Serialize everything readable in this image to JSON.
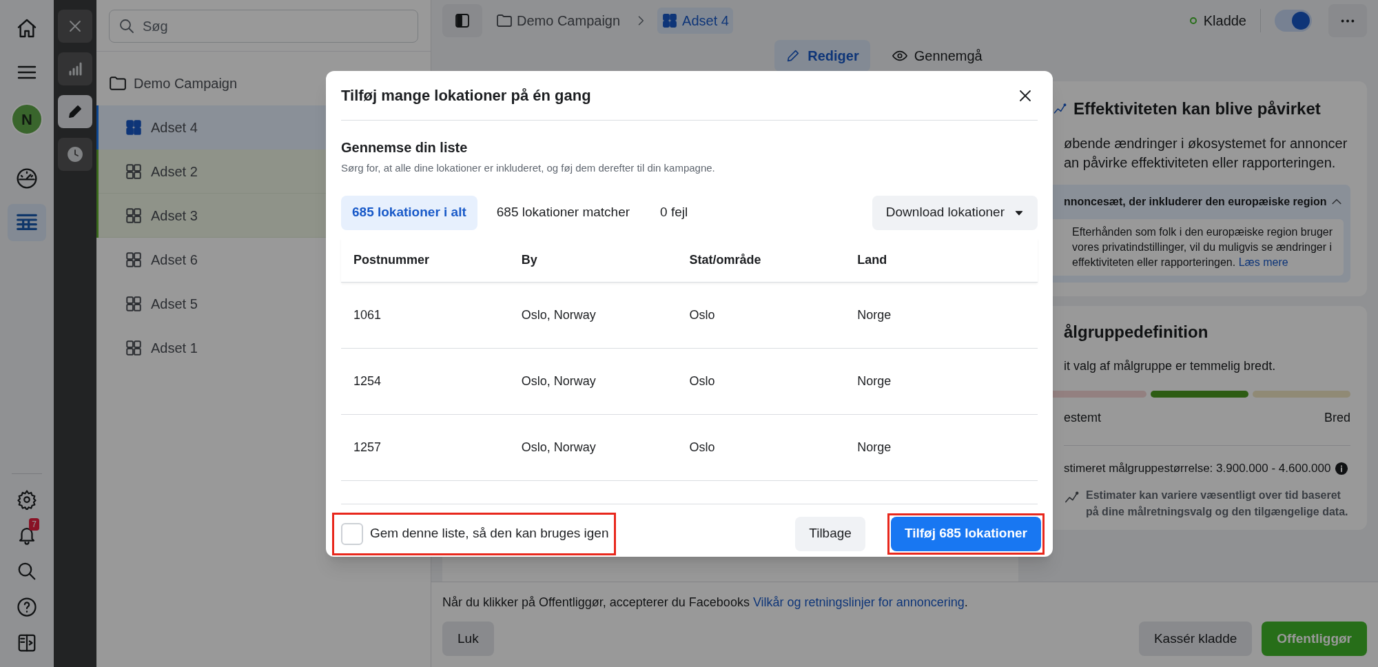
{
  "icon_rail": {
    "top_items": [
      {
        "kind": "home",
        "selected": false
      },
      {
        "kind": "menu",
        "selected": false
      },
      {
        "kind": "avatar",
        "selected": false,
        "letter": "N"
      },
      {
        "kind": "gauge",
        "selected": false
      },
      {
        "kind": "table",
        "selected": true
      }
    ],
    "bottom_items": [
      {
        "kind": "settings"
      },
      {
        "kind": "bell",
        "badge": "7"
      },
      {
        "kind": "search"
      },
      {
        "kind": "help"
      },
      {
        "kind": "panel"
      }
    ]
  },
  "tool_rail": {
    "items": [
      {
        "kind": "close",
        "selected": false
      },
      {
        "kind": "chart",
        "selected": false
      },
      {
        "kind": "edit",
        "selected": true
      },
      {
        "kind": "history",
        "selected": false
      }
    ]
  },
  "sidebar": {
    "search_placeholder": "Søg",
    "campaign": "Demo Campaign",
    "items": [
      {
        "label": "Adset 4",
        "selected": true,
        "changed": false
      },
      {
        "label": "Adset 2",
        "selected": false,
        "changed": true
      },
      {
        "label": "Adset 3",
        "selected": false,
        "changed": true
      },
      {
        "label": "Adset 6",
        "selected": false,
        "changed": false
      },
      {
        "label": "Adset 5",
        "selected": false,
        "changed": false
      },
      {
        "label": "Adset 1",
        "selected": false,
        "changed": false
      }
    ]
  },
  "topbar": {
    "breadcrumb": {
      "campaign": "Demo Campaign",
      "adset": "Adset 4"
    },
    "status": "Kladde",
    "toggle_on": true,
    "tabs": [
      {
        "label": "Rediger",
        "selected": true,
        "kind": "edit"
      },
      {
        "label": "Gennemgå",
        "selected": false,
        "kind": "view"
      }
    ]
  },
  "modal": {
    "title": "Tilføj mange lokationer på én gang",
    "section_title": "Gennemse din liste",
    "section_subtitle": "Sørg for, at alle dine lokationer er inkluderet, og føj dem derefter til din kampagne.",
    "filters": [
      {
        "label": "685 lokationer i alt",
        "selected": true
      },
      {
        "label": "685 lokationer matcher",
        "selected": false
      },
      {
        "label": "0 fejl",
        "selected": false
      }
    ],
    "download_button": "Download lokationer",
    "table": {
      "columns": [
        "Postnummer",
        "By",
        "Stat/område",
        "Land"
      ],
      "rows": [
        [
          "1061",
          "Oslo, Norway",
          "Oslo",
          "Norge"
        ],
        [
          "1254",
          "Oslo, Norway",
          "Oslo",
          "Norge"
        ],
        [
          "1257",
          "Oslo, Norway",
          "Oslo",
          "Norge"
        ]
      ]
    },
    "save_checkbox": {
      "label": "Gem denne liste, så den kan bruges igen",
      "checked": false
    },
    "back_button": "Tilbage",
    "add_button": "Tilføj 685 lokationer"
  },
  "right_panel": {
    "effect_card": {
      "title": "Effektiviteten kan blive påvirket",
      "body_lines": [
        "øbende ændringer i økosystemet for annoncer",
        "an påvirke effektiviteten eller rapporteringen."
      ],
      "notice": {
        "title": "nnoncesæt, der inkluderer den europæiske region",
        "expanded": true,
        "body": "Efterhånden som folk i den europæiske region bruger vores privatindstillinger, vil du muligvis se ændringer i effektiviteten eller rapporteringen.",
        "link": "Læs mere"
      }
    },
    "audience_card": {
      "title": "ålgruppedefinition",
      "description": "it valg af målgruppe er temmelig bredt.",
      "scale": {
        "segments": [
          {
            "selected": false
          },
          {
            "selected": true
          },
          {
            "selected": false
          }
        ],
        "left_label": "estemt",
        "right_label": "Bred"
      },
      "estimate": "stimeret målgruppestørrelse: 3.900.000 - 4.600.000",
      "note": "Estimater kan variere væsentligt over tid baseret på dine målretningsvalg og den tilgængelige data."
    }
  },
  "footer": {
    "notice": "Når du klikker på Offentliggør, accepterer du Facebooks",
    "link": "Vilkår og retningslinjer for annoncering",
    "notice_end": ".",
    "close_button": "Luk",
    "discard_button": "Kassér kladde",
    "publish_button": "Offentliggør"
  }
}
